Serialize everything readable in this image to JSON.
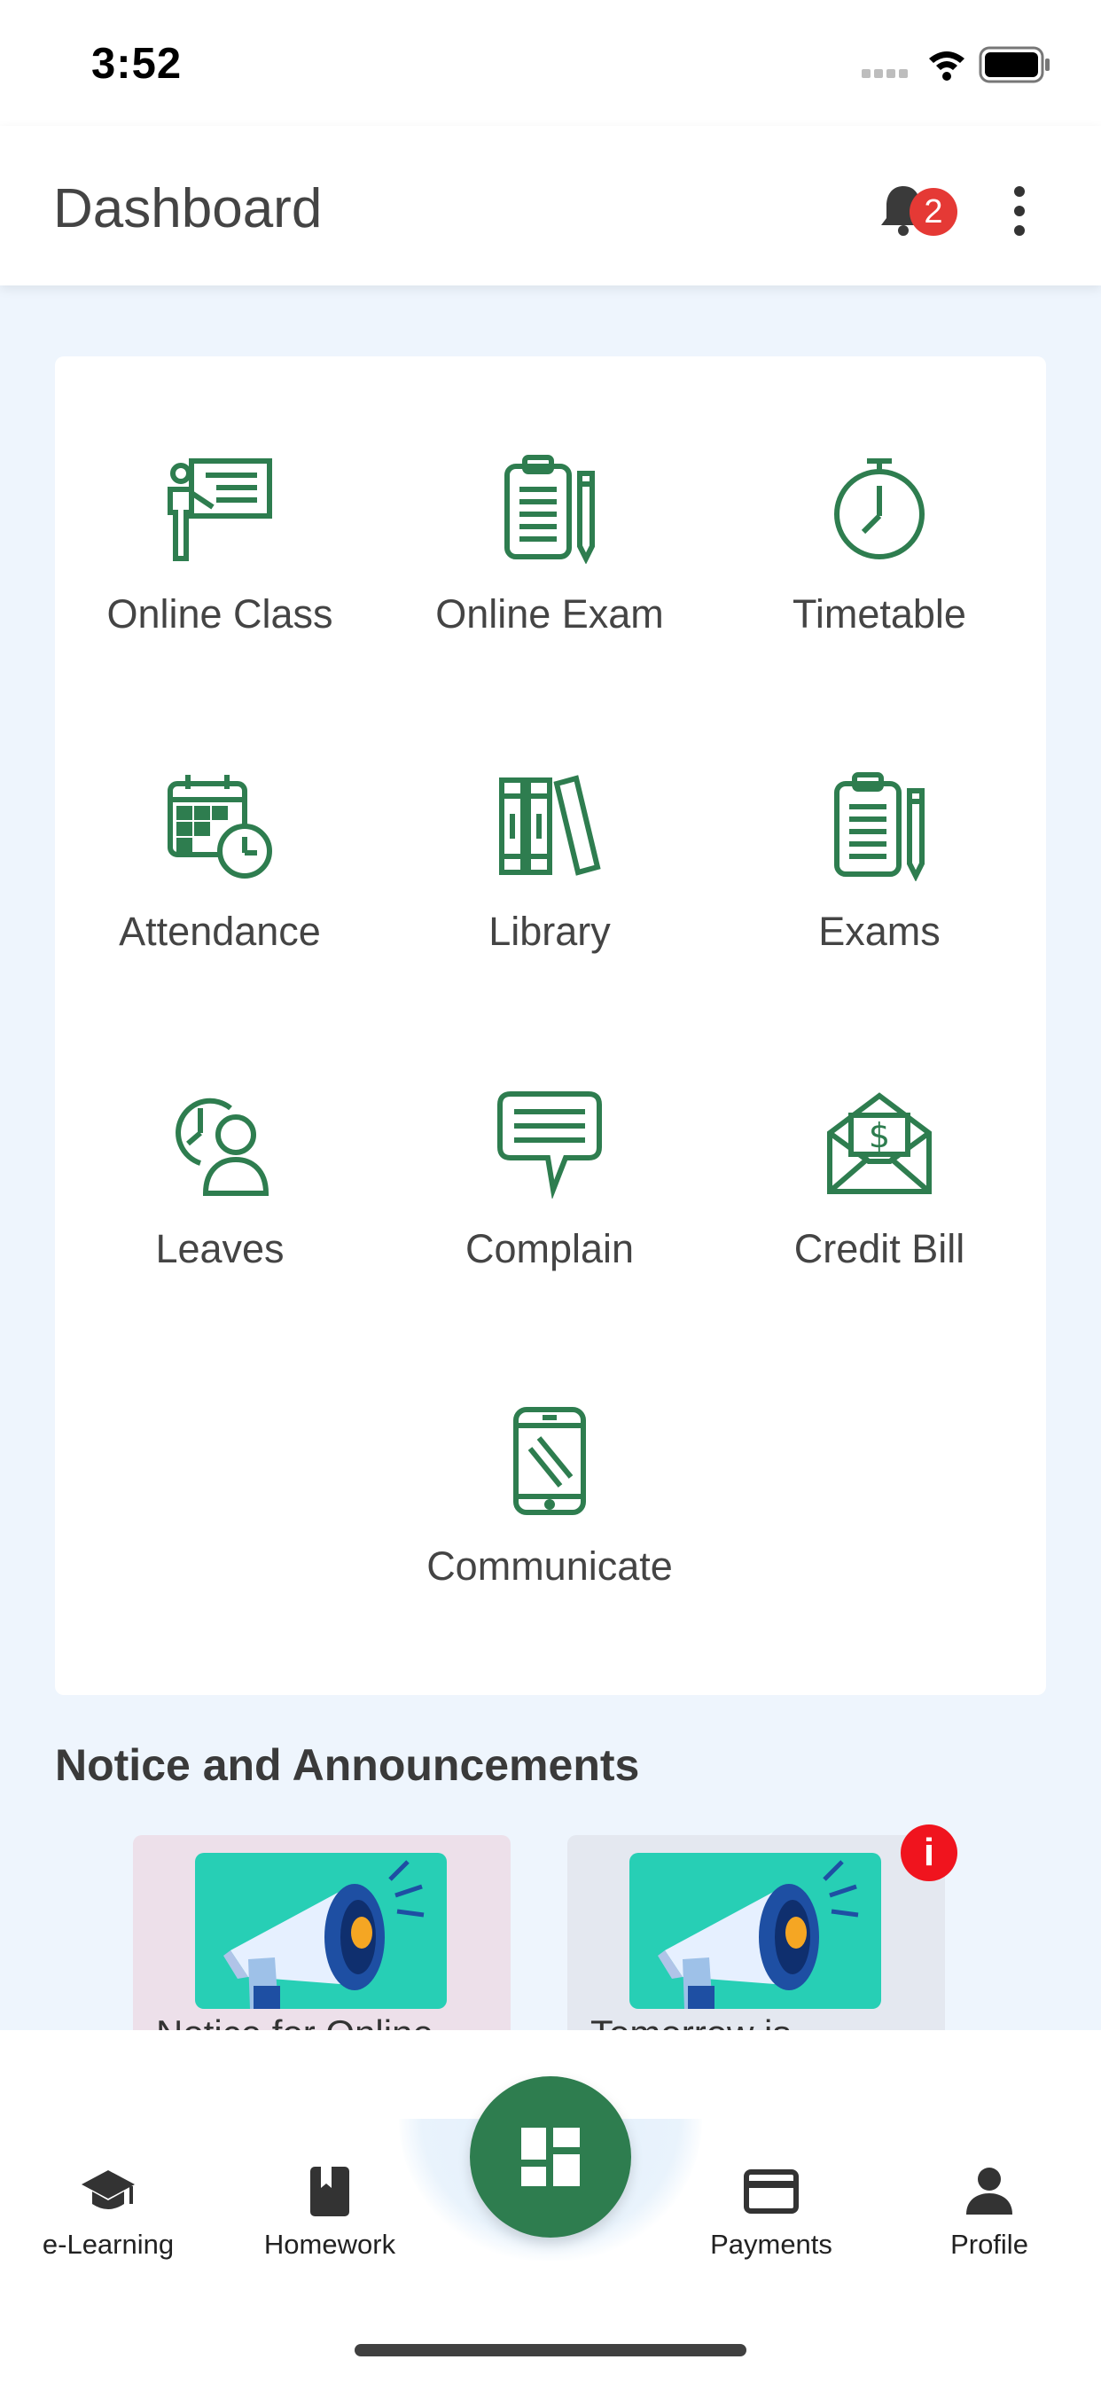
{
  "status_bar": {
    "time": "3:52"
  },
  "header": {
    "title": "Dashboard",
    "notification_count": "2"
  },
  "menu": [
    {
      "label": "Online Class",
      "icon": "presentation-icon"
    },
    {
      "label": "Online Exam",
      "icon": "clipboard-pencil-icon"
    },
    {
      "label": "Timetable",
      "icon": "stopwatch-icon"
    },
    {
      "label": "Attendance",
      "icon": "calendar-clock-icon"
    },
    {
      "label": "Library",
      "icon": "books-icon"
    },
    {
      "label": "Exams",
      "icon": "clipboard-pencil-icon"
    },
    {
      "label": "Leaves",
      "icon": "user-clock-icon"
    },
    {
      "label": "Complain",
      "icon": "chat-bubble-icon"
    },
    {
      "label": "Credit Bill",
      "icon": "envelope-dollar-icon"
    },
    {
      "label": "Communicate",
      "icon": "mobile-phone-icon"
    }
  ],
  "notices": {
    "title": "Notice and Announcements",
    "items": [
      {
        "text": "Notice for Online"
      },
      {
        "text": "Tomorrow is"
      }
    ],
    "info_badge": "i"
  },
  "bottom_nav": {
    "items": [
      {
        "label": "e-Learning",
        "icon": "graduation-cap-icon"
      },
      {
        "label": "Homework",
        "icon": "book-icon"
      },
      {
        "label": "Payments",
        "icon": "credit-card-icon"
      },
      {
        "label": "Profile",
        "icon": "person-icon"
      }
    ]
  },
  "colors": {
    "accent": "#2e7d4f",
    "background": "#eef5fd",
    "badge": "#e53935",
    "notice_card_1": "#ede0ea",
    "notice_card_2": "#e4e8f0",
    "notice_image": "#27cfb5"
  }
}
